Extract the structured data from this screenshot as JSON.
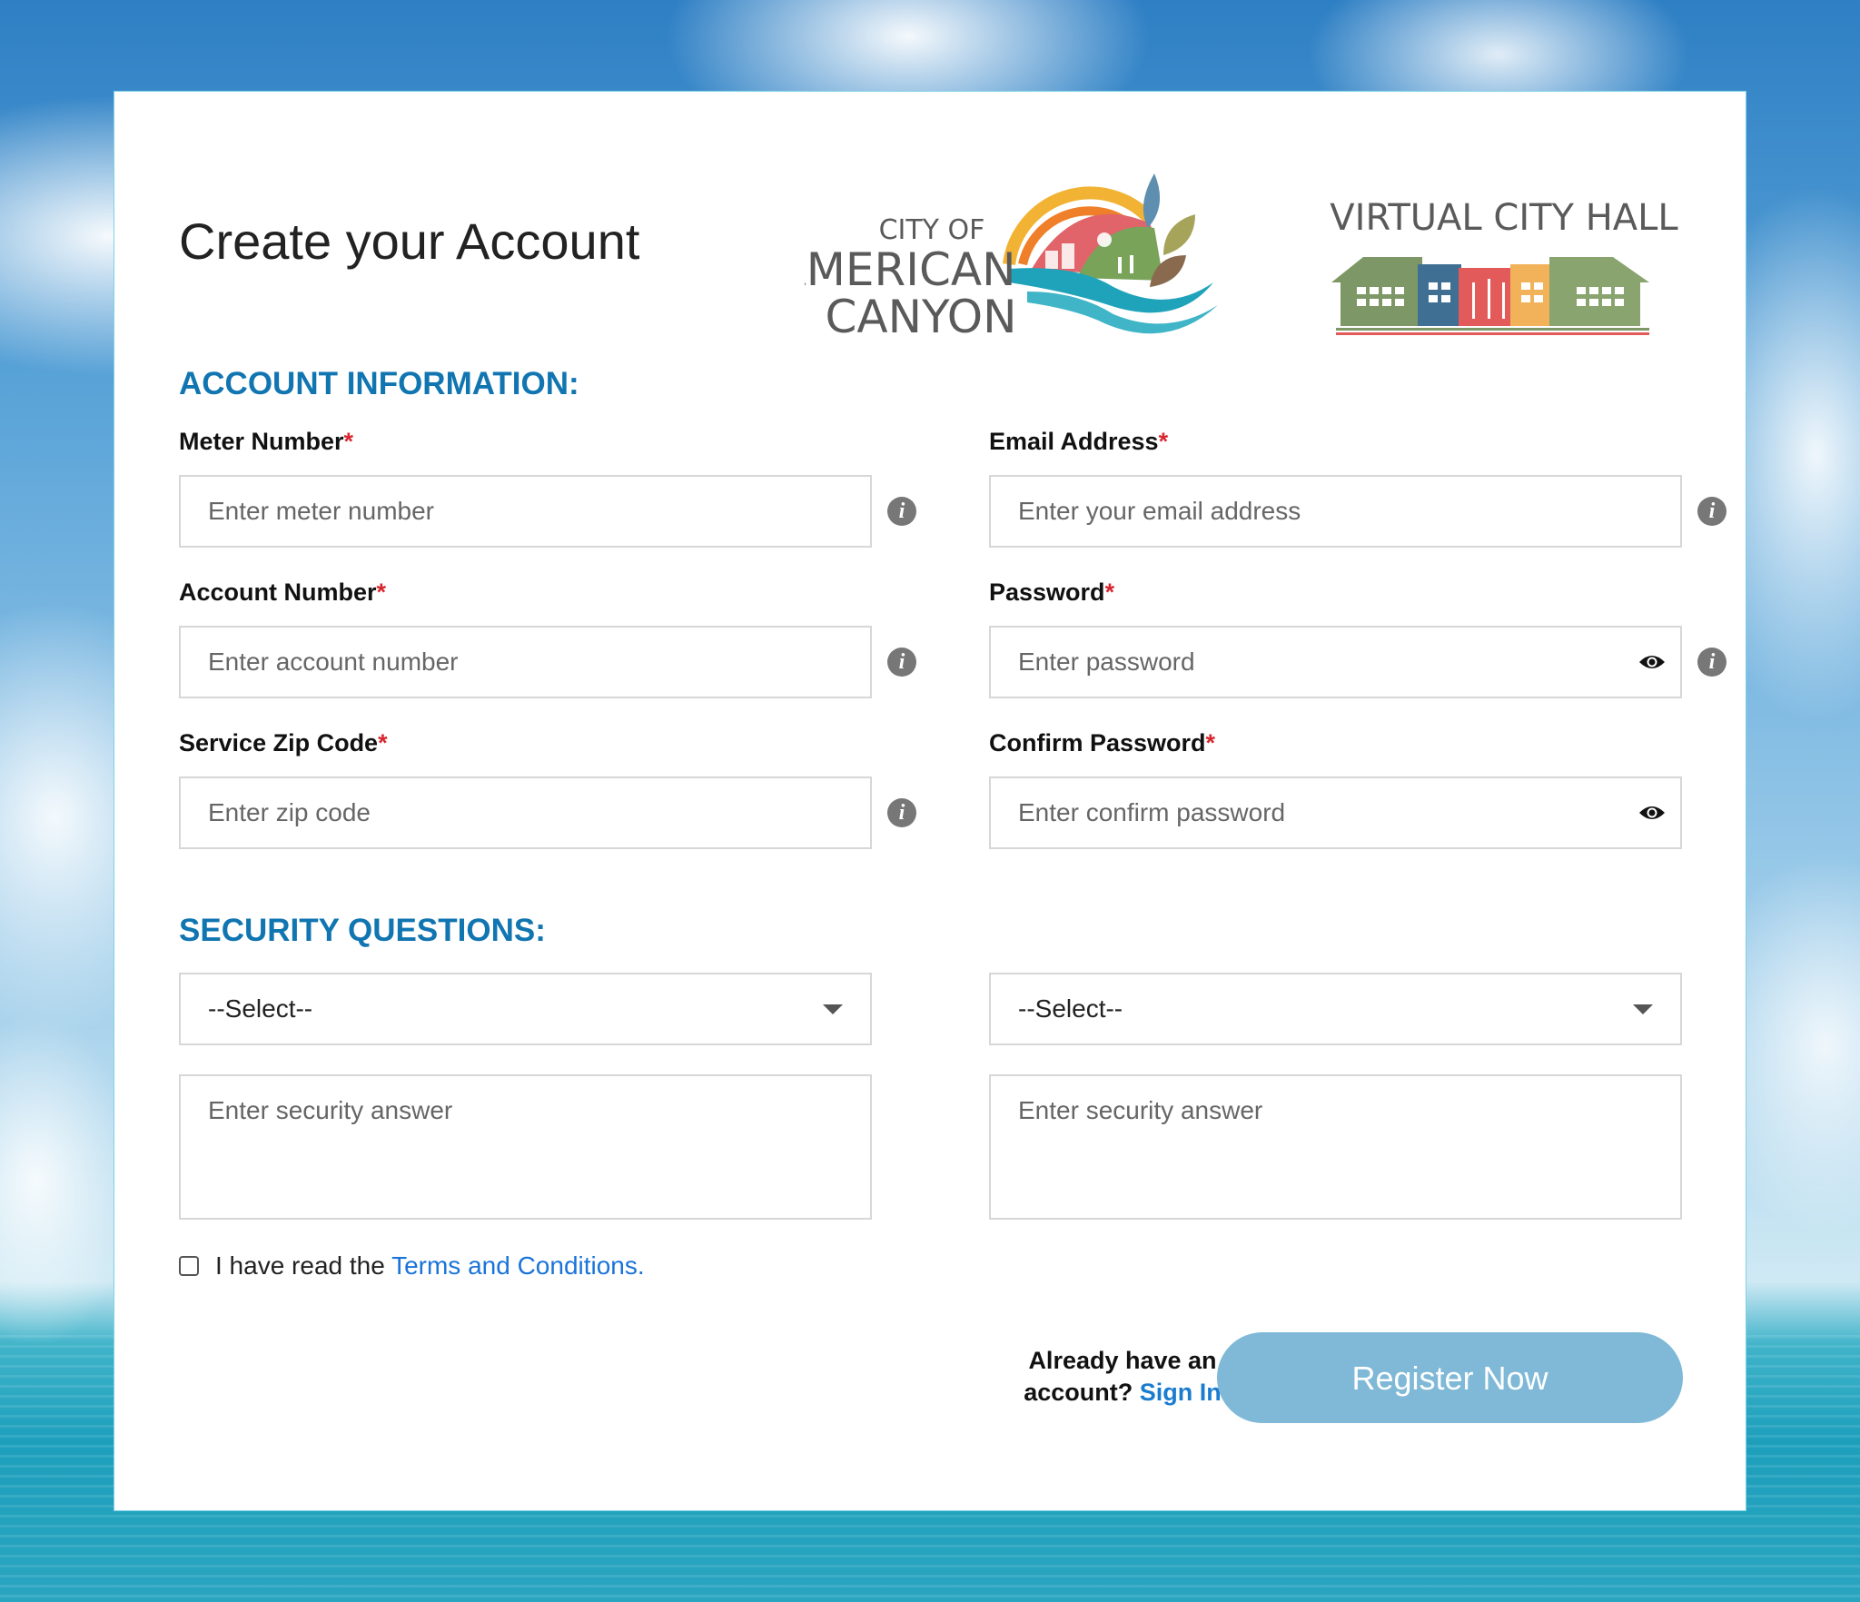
{
  "page": {
    "title": "Create your Account"
  },
  "logos": {
    "city": {
      "line1": "CITY OF",
      "line2": "AMERICAN",
      "line3": "CANYON"
    },
    "vch": {
      "text": "VIRTUAL CITY HALL"
    }
  },
  "account": {
    "heading": "ACCOUNT INFORMATION:",
    "meter": {
      "label": "Meter Number",
      "placeholder": "Enter meter number"
    },
    "email": {
      "label": "Email Address",
      "placeholder": "Enter your email address"
    },
    "account_number": {
      "label": "Account Number",
      "placeholder": "Enter account number"
    },
    "password": {
      "label": "Password",
      "placeholder": "Enter password"
    },
    "zip": {
      "label": "Service Zip Code",
      "placeholder": "Enter zip code"
    },
    "confirm_password": {
      "label": "Confirm Password",
      "placeholder": "Enter confirm password"
    },
    "required_marker": "*",
    "info_glyph": "i"
  },
  "security": {
    "heading": "SECURITY QUESTIONS:",
    "question1": {
      "selected": "--Select--",
      "answer_placeholder": "Enter security answer"
    },
    "question2": {
      "selected": "--Select--",
      "answer_placeholder": "Enter security answer"
    }
  },
  "terms": {
    "prefix": "I have read the ",
    "link": "Terms and Conditions."
  },
  "footer": {
    "already_line1": "Already have an",
    "already_line2": "account?",
    "signin": "Sign In",
    "register": "Register Now"
  },
  "colors": {
    "heading_blue": "#1175b1",
    "link_blue": "#1a73d9",
    "required_red": "#d8262f",
    "button_bg": "#7fb9d7"
  }
}
